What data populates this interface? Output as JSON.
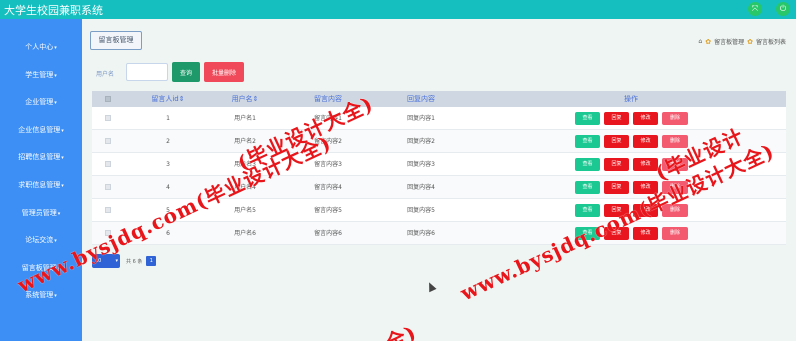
{
  "app": {
    "title": "大学生校园兼职系统"
  },
  "topbar": {
    "icons": [
      "network-icon",
      "logout-icon"
    ]
  },
  "sidebar": {
    "items": [
      {
        "label": "个人中心"
      },
      {
        "label": "学生管理"
      },
      {
        "label": "企业管理"
      },
      {
        "label": "企业信息管理"
      },
      {
        "label": "招聘信息管理"
      },
      {
        "label": "求职信息管理"
      },
      {
        "label": "管理员管理"
      },
      {
        "label": "论坛交流"
      },
      {
        "label": "留言板管理"
      },
      {
        "label": "系统管理"
      }
    ]
  },
  "page": {
    "title_button": "留言板管理",
    "breadcrumb": [
      "留言板管理",
      "留言板列表"
    ]
  },
  "search": {
    "label": "用户名",
    "value": "",
    "query_label": "查询",
    "batch_delete_label": "批量删除"
  },
  "table": {
    "columns": [
      "留言人id",
      "用户名",
      "留言内容",
      "回复内容",
      "操作"
    ],
    "sort_mark": "⇕",
    "rows": [
      {
        "id": "1",
        "username": "用户名1",
        "message": "留言内容1",
        "reply": "回复内容1"
      },
      {
        "id": "2",
        "username": "用户名2",
        "message": "留言内容2",
        "reply": "回复内容2"
      },
      {
        "id": "3",
        "username": "用户名3",
        "message": "留言内容3",
        "reply": "回复内容3"
      },
      {
        "id": "4",
        "username": "用户名4",
        "message": "留言内容4",
        "reply": "回复内容4"
      },
      {
        "id": "5",
        "username": "用户名5",
        "message": "留言内容5",
        "reply": "回复内容5"
      },
      {
        "id": "6",
        "username": "用户名6",
        "message": "留言内容6",
        "reply": "回复内容6"
      }
    ],
    "actions": {
      "view": "查看",
      "reply": "回复",
      "edit": "修改",
      "delete": "删除"
    }
  },
  "pager": {
    "page_size": "10",
    "total": "共 6 条",
    "current_page": "1"
  },
  "watermarks": [
    "www.bysjdq.com(毕业设计大全)",
    "www.bysjdq.com(毕业设计大全)",
    "(毕业设计大全)",
    "(毕业设计",
    "全)"
  ],
  "colors": {
    "topbar": "#16bfbf",
    "sidebar": "#3d8ff5",
    "primary": "#2f63d6",
    "view": "#1cc892",
    "danger": "#e8171f",
    "delete": "#f35a70",
    "watermark": "#e8161b"
  }
}
